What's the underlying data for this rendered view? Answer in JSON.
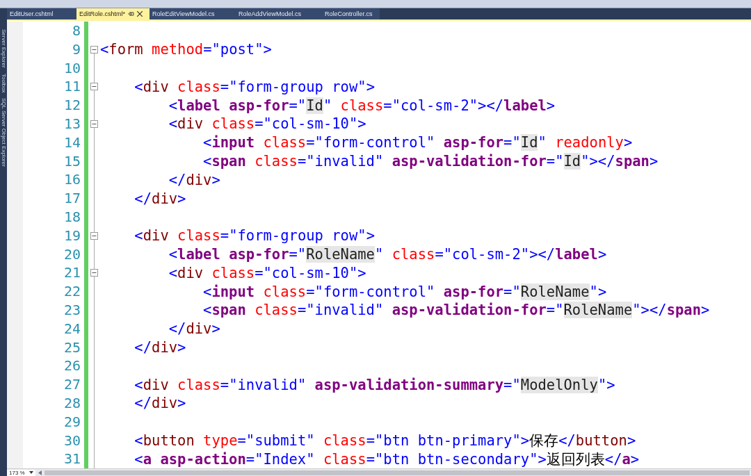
{
  "tool_windows": [
    "Server Explorer",
    "Toolbox",
    "SQL Server Object Explorer"
  ],
  "tabs": [
    {
      "label": "EditUser.cshtml",
      "selected": false
    },
    {
      "label": "EditRole.cshtml*",
      "selected": true
    },
    {
      "label": "RoleEditViewModel.cs",
      "selected": false
    },
    {
      "label": "RoleAddViewModel.cs",
      "selected": false
    },
    {
      "label": "RoleController.cs",
      "selected": false
    }
  ],
  "lines": [
    {
      "number": "8"
    },
    {
      "number": "9",
      "tokens": [
        {
          "kind": "punct",
          "text": "<"
        },
        {
          "kind": "elem",
          "text": "form"
        },
        {
          "kind": "attr",
          "text": " method"
        },
        {
          "kind": "punct",
          "text": "="
        },
        {
          "kind": "value",
          "text": "\"post\""
        },
        {
          "kind": "punct",
          "text": ">"
        }
      ],
      "children": [
        {
          "number": "10"
        },
        {
          "number": "11",
          "tokens": [
            {
              "kind": "punct",
              "text": "<"
            },
            {
              "kind": "elem",
              "text": "div"
            },
            {
              "kind": "attr",
              "text": " class"
            },
            {
              "kind": "punct",
              "text": "="
            },
            {
              "kind": "value",
              "text": "\"form-group row\""
            },
            {
              "kind": "punct",
              "text": ">"
            }
          ],
          "children": [
            {
              "number": "12",
              "tokens": [
                {
                  "kind": "punct",
                  "text": "<"
                },
                {
                  "kind": "helper",
                  "text": "label asp-for"
                },
                {
                  "kind": "punct",
                  "text": "=\""
                },
                {
                  "kind": "helper-value",
                  "text": "Id"
                },
                {
                  "kind": "punct",
                  "text": "\""
                },
                {
                  "kind": "attr",
                  "text": " class"
                },
                {
                  "kind": "punct",
                  "text": "="
                },
                {
                  "kind": "value",
                  "text": "\"col-sm-2\""
                },
                {
                  "kind": "punct",
                  "text": "></"
                },
                {
                  "kind": "helper",
                  "text": "label"
                },
                {
                  "kind": "punct",
                  "text": ">"
                }
              ]
            },
            {
              "number": "13",
              "tokens": [
                {
                  "kind": "punct",
                  "text": "<"
                },
                {
                  "kind": "elem",
                  "text": "div"
                },
                {
                  "kind": "attr",
                  "text": " class"
                },
                {
                  "kind": "punct",
                  "text": "="
                },
                {
                  "kind": "value",
                  "text": "\"col-sm-10\""
                },
                {
                  "kind": "punct",
                  "text": ">"
                }
              ],
              "children": [
                {
                  "number": "14",
                  "tokens": [
                    {
                      "kind": "punct",
                      "text": "<"
                    },
                    {
                      "kind": "helper",
                      "text": "input"
                    },
                    {
                      "kind": "attr",
                      "text": " class"
                    },
                    {
                      "kind": "punct",
                      "text": "="
                    },
                    {
                      "kind": "value",
                      "text": "\"form-control\""
                    },
                    {
                      "kind": "helper",
                      "text": " asp-for"
                    },
                    {
                      "kind": "punct",
                      "text": "=\""
                    },
                    {
                      "kind": "helper-value",
                      "text": "Id"
                    },
                    {
                      "kind": "punct",
                      "text": "\""
                    },
                    {
                      "kind": "attr",
                      "text": " readonly"
                    },
                    {
                      "kind": "punct",
                      "text": ">"
                    }
                  ]
                },
                {
                  "number": "15",
                  "tokens": [
                    {
                      "kind": "punct",
                      "text": "<"
                    },
                    {
                      "kind": "helper",
                      "text": "span"
                    },
                    {
                      "kind": "attr",
                      "text": " class"
                    },
                    {
                      "kind": "punct",
                      "text": "="
                    },
                    {
                      "kind": "value",
                      "text": "\"invalid\""
                    },
                    {
                      "kind": "helper",
                      "text": " asp-validation-for"
                    },
                    {
                      "kind": "punct",
                      "text": "=\""
                    },
                    {
                      "kind": "helper-value",
                      "text": "Id"
                    },
                    {
                      "kind": "punct",
                      "text": "\"></"
                    },
                    {
                      "kind": "helper",
                      "text": "span"
                    },
                    {
                      "kind": "punct",
                      "text": ">"
                    }
                  ]
                }
              ]
            },
            {
              "number": "16",
              "tokens": [
                {
                  "kind": "punct",
                  "text": "</"
                },
                {
                  "kind": "elem",
                  "text": "div"
                },
                {
                  "kind": "punct",
                  "text": ">"
                }
              ]
            }
          ]
        },
        {
          "number": "17",
          "tokens": [
            {
              "kind": "punct",
              "text": "</"
            },
            {
              "kind": "elem",
              "text": "div"
            },
            {
              "kind": "punct",
              "text": ">"
            }
          ]
        },
        {
          "number": "18"
        },
        {
          "number": "19",
          "tokens": [
            {
              "kind": "punct",
              "text": "<"
            },
            {
              "kind": "elem",
              "text": "div"
            },
            {
              "kind": "attr",
              "text": " class"
            },
            {
              "kind": "punct",
              "text": "="
            },
            {
              "kind": "value",
              "text": "\"form-group row\""
            },
            {
              "kind": "punct",
              "text": ">"
            }
          ],
          "children": [
            {
              "number": "20",
              "tokens": [
                {
                  "kind": "punct",
                  "text": "<"
                },
                {
                  "kind": "helper",
                  "text": "label asp-for"
                },
                {
                  "kind": "punct",
                  "text": "=\""
                },
                {
                  "kind": "helper-value",
                  "text": "RoleName"
                },
                {
                  "kind": "punct",
                  "text": "\""
                },
                {
                  "kind": "attr",
                  "text": " class"
                },
                {
                  "kind": "punct",
                  "text": "="
                },
                {
                  "kind": "value",
                  "text": "\"col-sm-2\""
                },
                {
                  "kind": "punct",
                  "text": "></"
                },
                {
                  "kind": "helper",
                  "text": "label"
                },
                {
                  "kind": "punct",
                  "text": ">"
                }
              ]
            },
            {
              "number": "21",
              "tokens": [
                {
                  "kind": "punct",
                  "text": "<"
                },
                {
                  "kind": "elem",
                  "text": "div"
                },
                {
                  "kind": "attr",
                  "text": " class"
                },
                {
                  "kind": "punct",
                  "text": "="
                },
                {
                  "kind": "value",
                  "text": "\"col-sm-10\""
                },
                {
                  "kind": "punct",
                  "text": ">"
                }
              ],
              "children": [
                {
                  "number": "22",
                  "tokens": [
                    {
                      "kind": "punct",
                      "text": "<"
                    },
                    {
                      "kind": "helper",
                      "text": "input"
                    },
                    {
                      "kind": "attr",
                      "text": " class"
                    },
                    {
                      "kind": "punct",
                      "text": "="
                    },
                    {
                      "kind": "value",
                      "text": "\"form-control\""
                    },
                    {
                      "kind": "helper",
                      "text": " asp-for"
                    },
                    {
                      "kind": "punct",
                      "text": "=\""
                    },
                    {
                      "kind": "helper-value",
                      "text": "RoleName"
                    },
                    {
                      "kind": "punct",
                      "text": "\">"
                    }
                  ]
                },
                {
                  "number": "23",
                  "tokens": [
                    {
                      "kind": "punct",
                      "text": "<"
                    },
                    {
                      "kind": "helper",
                      "text": "span"
                    },
                    {
                      "kind": "attr",
                      "text": " class"
                    },
                    {
                      "kind": "punct",
                      "text": "="
                    },
                    {
                      "kind": "value",
                      "text": "\"invalid\""
                    },
                    {
                      "kind": "helper",
                      "text": " asp-validation-for"
                    },
                    {
                      "kind": "punct",
                      "text": "=\""
                    },
                    {
                      "kind": "helper-value",
                      "text": "RoleName"
                    },
                    {
                      "kind": "punct",
                      "text": "\"></"
                    },
                    {
                      "kind": "helper",
                      "text": "span"
                    },
                    {
                      "kind": "punct",
                      "text": ">"
                    }
                  ]
                }
              ]
            },
            {
              "number": "24",
              "tokens": [
                {
                  "kind": "punct",
                  "text": "</"
                },
                {
                  "kind": "elem",
                  "text": "div"
                },
                {
                  "kind": "punct",
                  "text": ">"
                }
              ]
            }
          ]
        },
        {
          "number": "25",
          "tokens": [
            {
              "kind": "punct",
              "text": "</"
            },
            {
              "kind": "elem",
              "text": "div"
            },
            {
              "kind": "punct",
              "text": ">"
            }
          ]
        },
        {
          "number": "26"
        },
        {
          "number": "27",
          "tokens": [
            {
              "kind": "punct",
              "text": "<"
            },
            {
              "kind": "elem",
              "text": "div"
            },
            {
              "kind": "attr",
              "text": " class"
            },
            {
              "kind": "punct",
              "text": "="
            },
            {
              "kind": "value",
              "text": "\"invalid\""
            },
            {
              "kind": "helper",
              "text": " asp-validation-summary"
            },
            {
              "kind": "punct",
              "text": "=\""
            },
            {
              "kind": "helper-value",
              "text": "ModelOnly"
            },
            {
              "kind": "punct",
              "text": "\">"
            }
          ]
        },
        {
          "number": "28",
          "tokens": [
            {
              "kind": "punct",
              "text": "</"
            },
            {
              "kind": "elem",
              "text": "div"
            },
            {
              "kind": "punct",
              "text": ">"
            }
          ]
        },
        {
          "number": "29"
        },
        {
          "number": "30",
          "tokens": [
            {
              "kind": "punct",
              "text": "<"
            },
            {
              "kind": "elem",
              "text": "button"
            },
            {
              "kind": "attr",
              "text": " type"
            },
            {
              "kind": "punct",
              "text": "="
            },
            {
              "kind": "value",
              "text": "\"submit\""
            },
            {
              "kind": "attr",
              "text": " class"
            },
            {
              "kind": "punct",
              "text": "="
            },
            {
              "kind": "value",
              "text": "\"btn btn-primary\""
            },
            {
              "kind": "punct",
              "text": ">"
            },
            {
              "kind": "text",
              "text": "保存"
            },
            {
              "kind": "punct",
              "text": "</"
            },
            {
              "kind": "elem",
              "text": "button"
            },
            {
              "kind": "punct",
              "text": ">"
            }
          ]
        },
        {
          "number": "31",
          "tokens": [
            {
              "kind": "punct",
              "text": "<"
            },
            {
              "kind": "helper",
              "text": "a asp-action"
            },
            {
              "kind": "punct",
              "text": "="
            },
            {
              "kind": "value",
              "text": "\"Index\""
            },
            {
              "kind": "attr",
              "text": " class"
            },
            {
              "kind": "punct",
              "text": "="
            },
            {
              "kind": "value",
              "text": "\"btn btn-secondary\""
            },
            {
              "kind": "punct",
              "text": ">"
            },
            {
              "kind": "text",
              "text": "返回列表"
            },
            {
              "kind": "punct",
              "text": "</"
            },
            {
              "kind": "helper",
              "text": "a"
            },
            {
              "kind": "punct",
              "text": ">"
            }
          ]
        }
      ]
    }
  ],
  "zoom": "173 %"
}
